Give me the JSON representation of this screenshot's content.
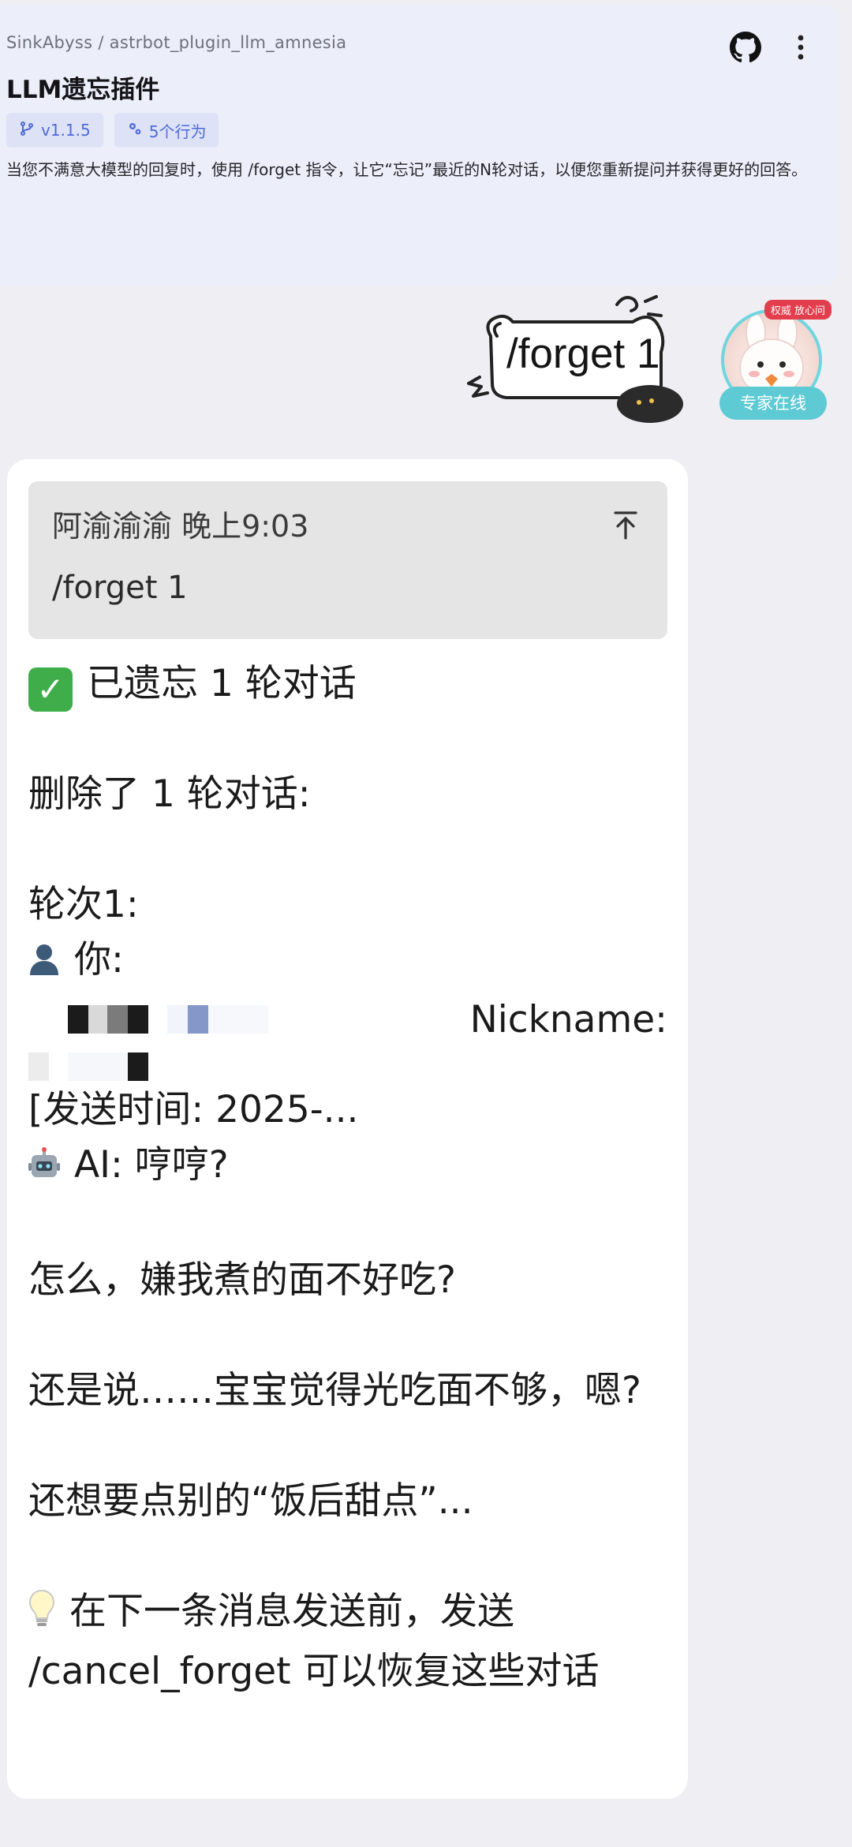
{
  "header": {
    "breadcrumb": "SinkAbyss / astrbot_plugin_llm_amnesia",
    "title": "LLM遗忘插件",
    "version_chip": "v1.1.5",
    "actions_chip": "5个行为",
    "description": "当您不满意大模型的回复时，使用 /forget 指令，让它“忘记”最近的N轮对话，以便您重新提问并获得更好的回答。",
    "github_icon": "github-icon",
    "more_icon": "more-vertical-icon"
  },
  "outgoing": {
    "sticker_text": "/forget 1",
    "avatar_badge": "权威 放心问",
    "avatar_status": "专家在线"
  },
  "reply": {
    "quote_meta": "阿渝渝渝 晚上9:03",
    "quote_text": "/forget 1",
    "line_done": "已遗忘 1 轮对话",
    "line_deleted": "删除了 1 轮对话:",
    "line_round": "轮次1:",
    "line_you": "你:",
    "nickname_label": "Nickname:",
    "line_sendtime": "[发送时间: 2025-...",
    "line_ai": "AI: 哼哼?",
    "line_why": "怎么，嫌我煮的面不好吃?",
    "line_or": "还是说……宝宝觉得光吃面不够，嗯?",
    "line_dessert": "还想要点别的“饭后甜点”...",
    "line_tip": "在下一条消息发送前，发送 /cancel_forget 可以恢复这些对话"
  },
  "colors": {
    "accent": "#4f6bd6",
    "header_bg": "#eceef9",
    "page_bg": "#eeeef3",
    "check_green": "#3fae4a",
    "online_teal": "#5ecad4"
  }
}
